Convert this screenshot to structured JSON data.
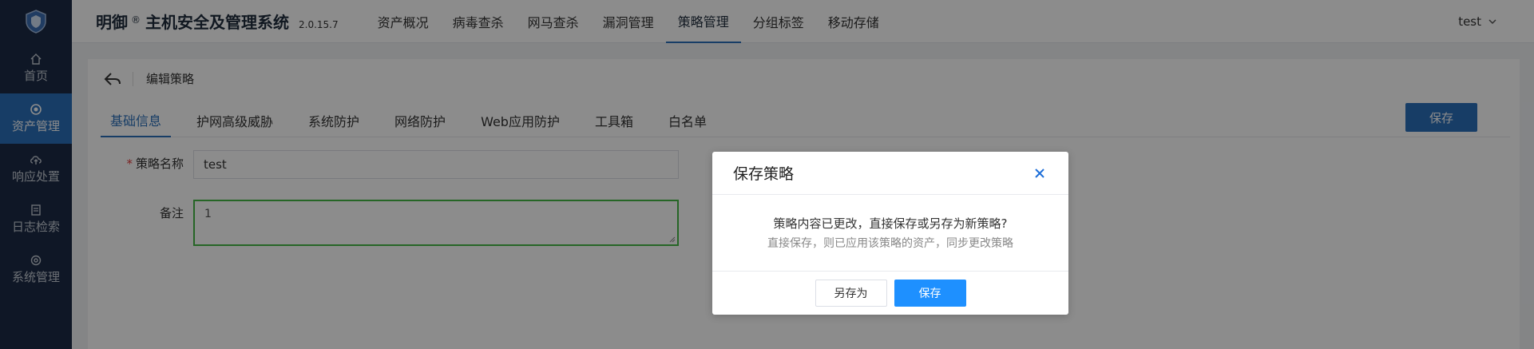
{
  "sidebar": {
    "items": [
      {
        "label": "首页",
        "icon": "home-icon"
      },
      {
        "label": "资产管理",
        "icon": "asset-icon"
      },
      {
        "label": "响应处置",
        "icon": "cloud-upload-icon"
      },
      {
        "label": "日志检索",
        "icon": "log-icon"
      },
      {
        "label": "系统管理",
        "icon": "settings-icon"
      }
    ],
    "active_index": 1
  },
  "header": {
    "brand": "明御",
    "brand_mark": "®",
    "brand_sub": "主机安全及管理系统",
    "version": "2.0.15.7",
    "nav": [
      "资产概况",
      "病毒查杀",
      "网马查杀",
      "漏洞管理",
      "策略管理",
      "分组标签",
      "移动存储"
    ],
    "active_nav": 4,
    "user": "test"
  },
  "page": {
    "title": "编辑策略",
    "tabs": [
      "基础信息",
      "护网高级威胁",
      "系统防护",
      "网络防护",
      "Web应用防护",
      "工具箱",
      "白名单"
    ],
    "active_tab": 0,
    "save_label": "保存",
    "form": {
      "name_label": "策略名称",
      "name_required": "*",
      "name_value": "test",
      "note_label": "备注",
      "note_value": "1"
    }
  },
  "modal": {
    "title": "保存策略",
    "message": "策略内容已更改，直接保存或另存为新策略?",
    "hint": "直接保存，则已应用该策略的资产，同步更改策略",
    "save_as_label": "另存为",
    "save_label": "保存"
  },
  "colors": {
    "sidebar_bg": "#1d2b45",
    "accent": "#2b6fba",
    "primary_button": "#1e90ff",
    "focus_border": "#46b946",
    "required": "#e23c3c"
  }
}
